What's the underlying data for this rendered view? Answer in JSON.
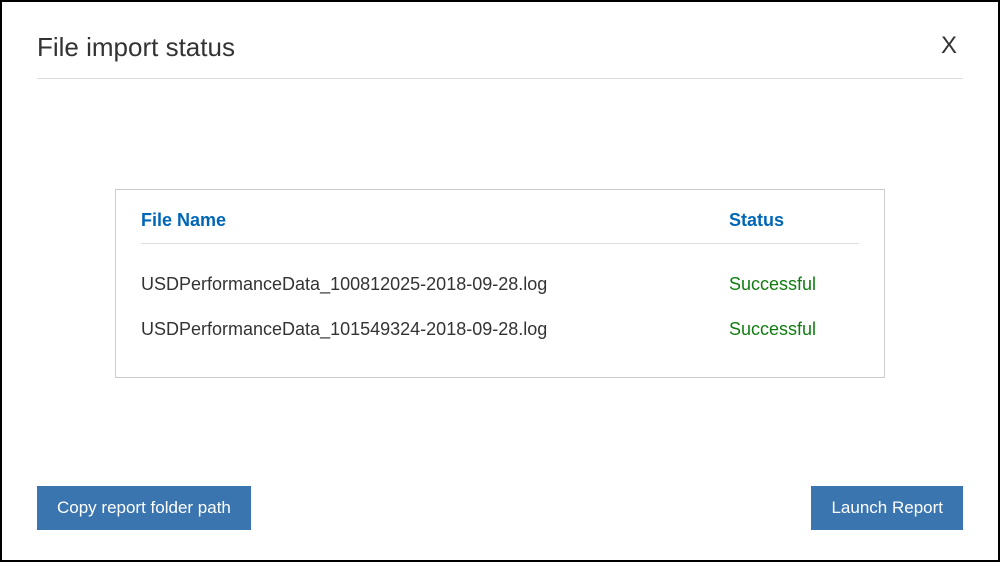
{
  "header": {
    "title": "File import status",
    "close_label": "X"
  },
  "table": {
    "columns": {
      "filename": "File Name",
      "status": "Status"
    },
    "rows": [
      {
        "filename": "USDPerformanceData_100812025-2018-09-28.log",
        "status": "Successful"
      },
      {
        "filename": "USDPerformanceData_101549324-2018-09-28.log",
        "status": "Successful"
      }
    ]
  },
  "footer": {
    "copy_path_label": "Copy report folder path",
    "launch_report_label": "Launch Report"
  }
}
